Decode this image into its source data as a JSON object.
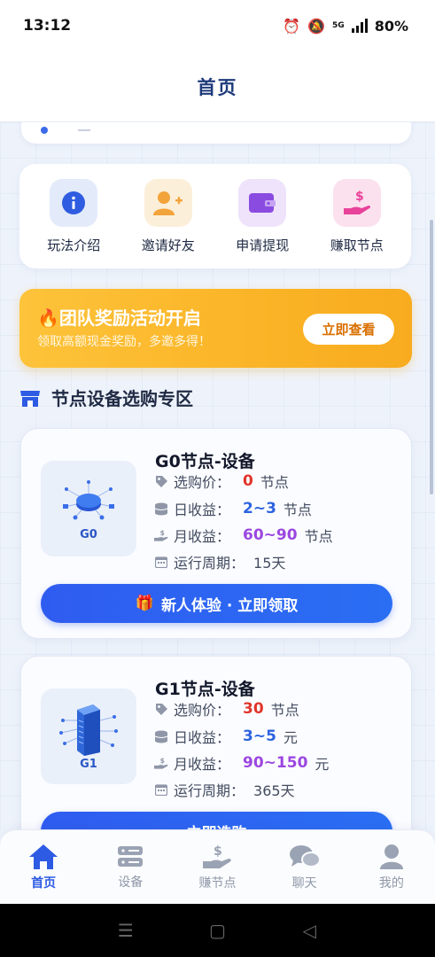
{
  "status_bar": {
    "time": "13:12",
    "network": "5G",
    "battery": "80%"
  },
  "header": {
    "title": "首页"
  },
  "quick_actions": [
    {
      "label": "玩法介绍",
      "icon": "info-icon",
      "color": "#2f5ce0"
    },
    {
      "label": "邀请好友",
      "icon": "add-user-icon",
      "color": "#f2a33a"
    },
    {
      "label": "申请提现",
      "icon": "wallet-icon",
      "color": "#8a4be0"
    },
    {
      "label": "赚取节点",
      "icon": "hand-dollar-icon",
      "color": "#e8429a"
    }
  ],
  "promo": {
    "title": "🔥团队奖励活动开启",
    "subtitle": "领取高额现金奖励，多邀多得！",
    "button": "立即查看"
  },
  "section": {
    "title": "节点设备选购专区",
    "icon": "store-icon"
  },
  "devices": [
    {
      "name": "G0节点-设备",
      "image_label": "G0",
      "price_label": "选购价：",
      "price_value": "0",
      "price_unit": "节点",
      "daily_label": "日收益：",
      "daily_value": "2~3",
      "daily_unit": "节点",
      "monthly_label": "月收益：",
      "monthly_value": "60~90",
      "monthly_unit": "节点",
      "period_label": "运行周期：",
      "period_value": "15天",
      "button": "新人体验 · 立即领取",
      "button_icon": "gift-icon"
    },
    {
      "name": "G1节点-设备",
      "image_label": "G1",
      "price_label": "选购价：",
      "price_value": "30",
      "price_unit": "节点",
      "daily_label": "日收益：",
      "daily_value": "3~5",
      "daily_unit": "元",
      "monthly_label": "月收益：",
      "monthly_value": "90~150",
      "monthly_unit": "元",
      "period_label": "运行周期：",
      "period_value": "365天",
      "button": "立即选购"
    }
  ],
  "bottom_nav": [
    {
      "label": "首页",
      "icon": "home-icon",
      "active": true
    },
    {
      "label": "设备",
      "icon": "device-icon",
      "active": false
    },
    {
      "label": "赚节点",
      "icon": "hand-dollar-icon",
      "active": false
    },
    {
      "label": "聊天",
      "icon": "chat-icon",
      "active": false
    },
    {
      "label": "我的",
      "icon": "user-icon",
      "active": false
    }
  ],
  "colors": {
    "accent": "#2d5be3",
    "promo": "#fbb427",
    "red": "#e0352b",
    "purple": "#9b47e0"
  }
}
